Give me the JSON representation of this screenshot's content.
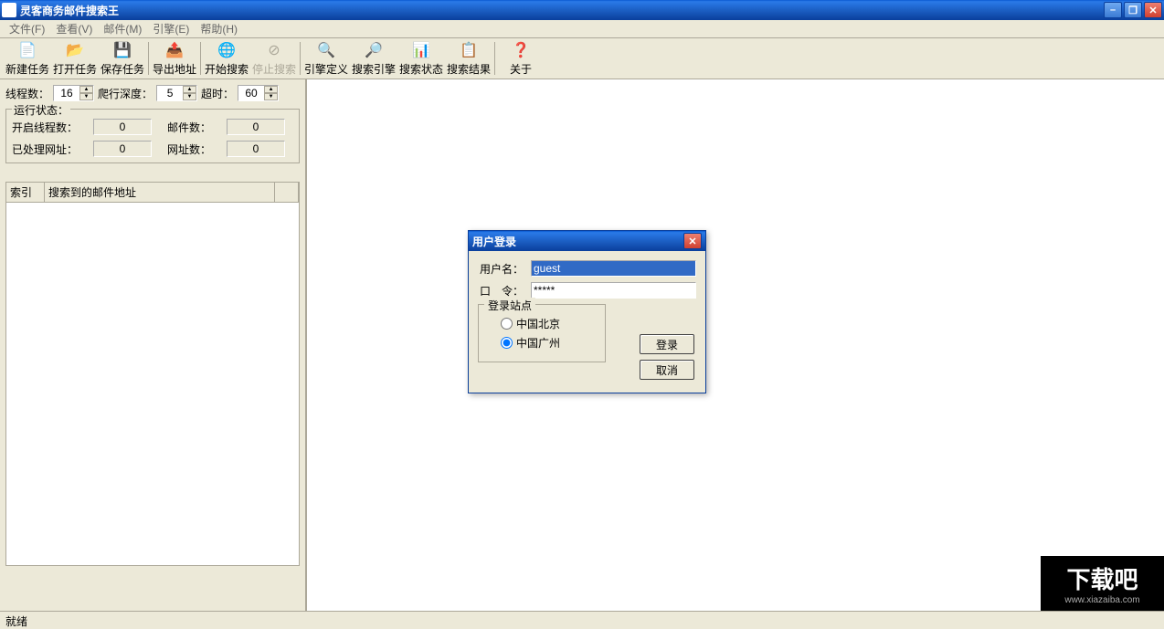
{
  "window": {
    "title": "灵客商务邮件搜索王"
  },
  "menu": {
    "file": "文件(F)",
    "view": "查看(V)",
    "mail": "邮件(M)",
    "engine": "引擎(E)",
    "help": "帮助(H)"
  },
  "toolbar": {
    "new_task": "新建任务",
    "open_task": "打开任务",
    "save_task": "保存任务",
    "export_addr": "导出地址",
    "start_search": "开始搜索",
    "stop_search": "停止搜索",
    "engine_def": "引擎定义",
    "search_engine": "搜索引擎",
    "search_status": "搜索状态",
    "search_result": "搜索结果",
    "about": "关于"
  },
  "params": {
    "threads_label": "线程数：",
    "threads_value": "16",
    "depth_label": "爬行深度：",
    "depth_value": "5",
    "timeout_label": "超时：",
    "timeout_value": "60"
  },
  "status": {
    "title": "运行状态：",
    "open_threads_label": "开启线程数：",
    "open_threads_value": "0",
    "mail_count_label": "邮件数：",
    "mail_count_value": "0",
    "processed_label": "已处理网址：",
    "processed_value": "0",
    "url_count_label": "网址数：",
    "url_count_value": "0"
  },
  "list": {
    "col_index": "索引",
    "col_addr": "搜索到的邮件地址"
  },
  "dialog": {
    "title": "用户登录",
    "username_label": "用户名：",
    "username_value": "guest",
    "password_label": "口　令：",
    "password_value": "*****",
    "site_title": "登录站点",
    "site_beijing": "中国北京",
    "site_guangzhou": "中国广州",
    "login_btn": "登录",
    "cancel_btn": "取消"
  },
  "statusbar": {
    "text": "就绪"
  },
  "watermark": {
    "main": "下载吧",
    "sub": "www.xiazaiba.com"
  }
}
